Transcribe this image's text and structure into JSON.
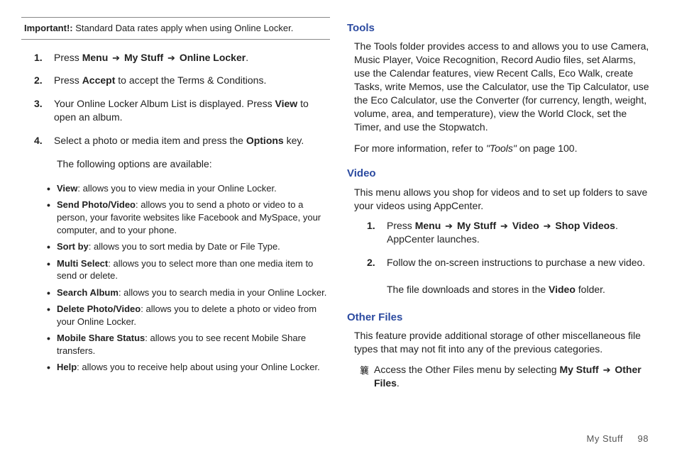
{
  "important": {
    "label": "Important!:",
    "text": "Standard Data rates apply when using Online Locker."
  },
  "steps": {
    "s1": {
      "num": "1.",
      "pre": "Press ",
      "b1": "Menu",
      "a1": "➔",
      "b2": "My Stuff",
      "a2": "➔",
      "b3": "Online Locker",
      "post": "."
    },
    "s2": {
      "num": "2.",
      "pre": "Press ",
      "b1": "Accept",
      "post": " to accept the Terms & Conditions."
    },
    "s3": {
      "num": "3.",
      "pre": "Your Online Locker Album List is displayed. Press ",
      "b1": "View",
      "post": " to open an album."
    },
    "s4": {
      "num": "4.",
      "pre": "Select a photo or media item and press the ",
      "b1": "Options",
      "post": " key."
    },
    "s4_sub": "The following options are available:"
  },
  "bullets": {
    "b1": {
      "t": "View",
      "d": ": allows you to view media in your Online Locker."
    },
    "b2": {
      "t": "Send Photo/Video",
      "d": ": allows you to send a photo or video to a person, your favorite websites like Facebook and MySpace, your computer, and to your phone."
    },
    "b3": {
      "t": "Sort by",
      "d": ": allows you to sort media by Date or File Type."
    },
    "b4": {
      "t": "Multi Select",
      "d": ": allows you to select more than one media item to send or delete."
    },
    "b5": {
      "t": "Search Album",
      "d": ": allows you to search media in your Online Locker."
    },
    "b6": {
      "t": "Delete Photo/Video",
      "d": ": allows you to delete a photo or video from your Online Locker."
    },
    "b7": {
      "t": "Mobile Share Status",
      "d": ": allows you to see recent Mobile Share transfers."
    },
    "b8": {
      "t": "Help",
      "d": ": allows you to receive help about using your Online Locker."
    }
  },
  "tools": {
    "head": "Tools",
    "p1": "The Tools folder provides access to and allows you to use Camera, Music Player, Voice Recognition, Record Audio files, set Alarms, use the Calendar features, view Recent Calls, Eco Walk, create Tasks, write Memos, use the Calculator, use the Tip Calculator, use the Eco Calculator, use the Converter (for currency, length, weight, volume, area, and temperature), view the World Clock, set the Timer, and use the Stopwatch.",
    "p2_pre": "For more information, refer to ",
    "p2_ref": "\"Tools\"",
    "p2_post": " on page 100."
  },
  "video": {
    "head": "Video",
    "p1": "This menu allows you shop for videos and to set up folders to save your videos using AppCenter.",
    "s1": {
      "num": "1.",
      "pre": "Press ",
      "b1": "Menu",
      "a1": "➔",
      "b2": "My Stuff",
      "a2": "➔",
      "b3": "Video",
      "a3": "➔",
      "b4": "Shop Videos",
      "post": ". AppCenter launches."
    },
    "s2": {
      "num": "2.",
      "line": "Follow the on-screen instructions to purchase a new video.",
      "sub_pre": "The file downloads and stores in the ",
      "sub_b": "Video",
      "sub_post": " folder."
    }
  },
  "other": {
    "head": "Other Files",
    "p1": "This feature provide additional storage of other miscellaneous file types that may not fit into any of the previous categories.",
    "arrow": "䉴",
    "a_pre": "Access the Other Files menu by selecting ",
    "b1": "My Stuff",
    "a1": "➔",
    "b2": "Other Files",
    "post": "."
  },
  "footer": {
    "section": "My Stuff",
    "page": "98"
  }
}
